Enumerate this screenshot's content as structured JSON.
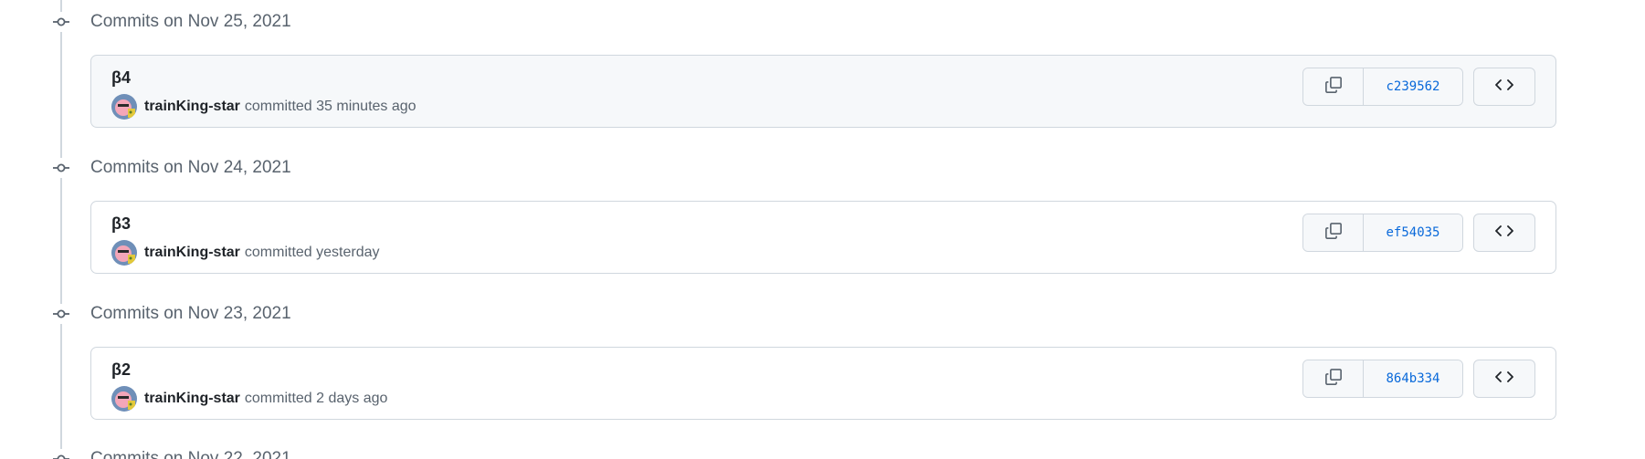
{
  "groups": [
    {
      "date_label": "Commits on Nov 25, 2021",
      "commit": {
        "title": "β4",
        "author": "trainKing-star",
        "action": "committed",
        "time": "35 minutes ago",
        "sha": "c239562",
        "highlighted": true
      }
    },
    {
      "date_label": "Commits on Nov 24, 2021",
      "commit": {
        "title": "β3",
        "author": "trainKing-star",
        "action": "committed",
        "time": "yesterday",
        "sha": "ef54035",
        "highlighted": false
      }
    },
    {
      "date_label": "Commits on Nov 23, 2021",
      "commit": {
        "title": "β2",
        "author": "trainKing-star",
        "action": "committed",
        "time": "2 days ago",
        "sha": "864b334",
        "highlighted": false
      }
    },
    {
      "date_label": "Commits on Nov 22, 2021"
    }
  ],
  "icons": {
    "commit_node": "git-commit-icon",
    "copy": "copy-icon",
    "browse": "code-icon"
  },
  "colors": {
    "link": "#0969da",
    "muted": "#59636e",
    "border": "#d0d7de",
    "highlight_bg": "#f6f8fa"
  }
}
